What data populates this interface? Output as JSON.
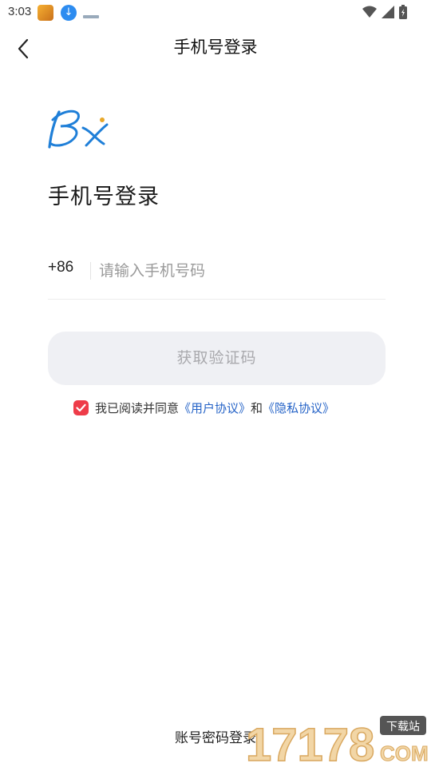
{
  "status_bar": {
    "time": "3:03",
    "icons": [
      "app-icon",
      "download-icon",
      "notification-icon",
      "wifi-icon",
      "signal-icon",
      "battery-icon"
    ]
  },
  "nav": {
    "title": "手机号登录",
    "back_icon": "chevron-left-icon"
  },
  "logo": {
    "text": "Bx"
  },
  "heading": "手机号登录",
  "phone": {
    "country_code": "+86",
    "placeholder": "请输入手机号码",
    "value": ""
  },
  "get_code_label": "获取验证码",
  "agreement": {
    "checked": true,
    "prefix": "我已阅读并同意",
    "user_agreement": "《用户协议》",
    "and": "和",
    "privacy_agreement": "《隐私协议》"
  },
  "account_login_label": "账号密码登录",
  "watermark": {
    "numbers": "17178",
    "domain": "COM",
    "tag": "下载站"
  },
  "colors": {
    "accent_red": "#ee3c49",
    "link_blue": "#2563c7",
    "button_bg": "#eff0f4",
    "button_text": "#a9a9ad"
  }
}
